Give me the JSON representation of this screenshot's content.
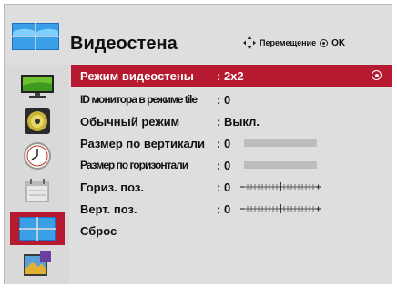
{
  "header": {
    "title": "Видеостена",
    "hint_move": "Перемещение",
    "hint_ok": "OK"
  },
  "sidebar": {
    "items": [
      {
        "icon": "display-icon"
      },
      {
        "icon": "speaker-icon"
      },
      {
        "icon": "clock-icon"
      },
      {
        "icon": "option-icon"
      },
      {
        "icon": "video-wall-icon",
        "active": true
      },
      {
        "icon": "picture-icon"
      }
    ]
  },
  "menu": {
    "rows": [
      {
        "label": "Режим видеостены",
        "value": ": 2x2"
      },
      {
        "label": "ID монитора в режиме tile",
        "value": ": 0"
      },
      {
        "label": "Обычный режим",
        "value": ": Выкл."
      },
      {
        "label": "Размер по вертикали",
        "value": ": 0"
      },
      {
        "label": "Размер по горизонтали",
        "value": ": 0"
      },
      {
        "label": "Гориз. поз.",
        "value": ": 0"
      },
      {
        "label": "Верт. поз.",
        "value": ": 0"
      },
      {
        "label": "Сброс",
        "value": ""
      }
    ]
  },
  "colors": {
    "accent": "#b51a30",
    "background": "#dedede",
    "sidebar": "#d9d9d9"
  }
}
